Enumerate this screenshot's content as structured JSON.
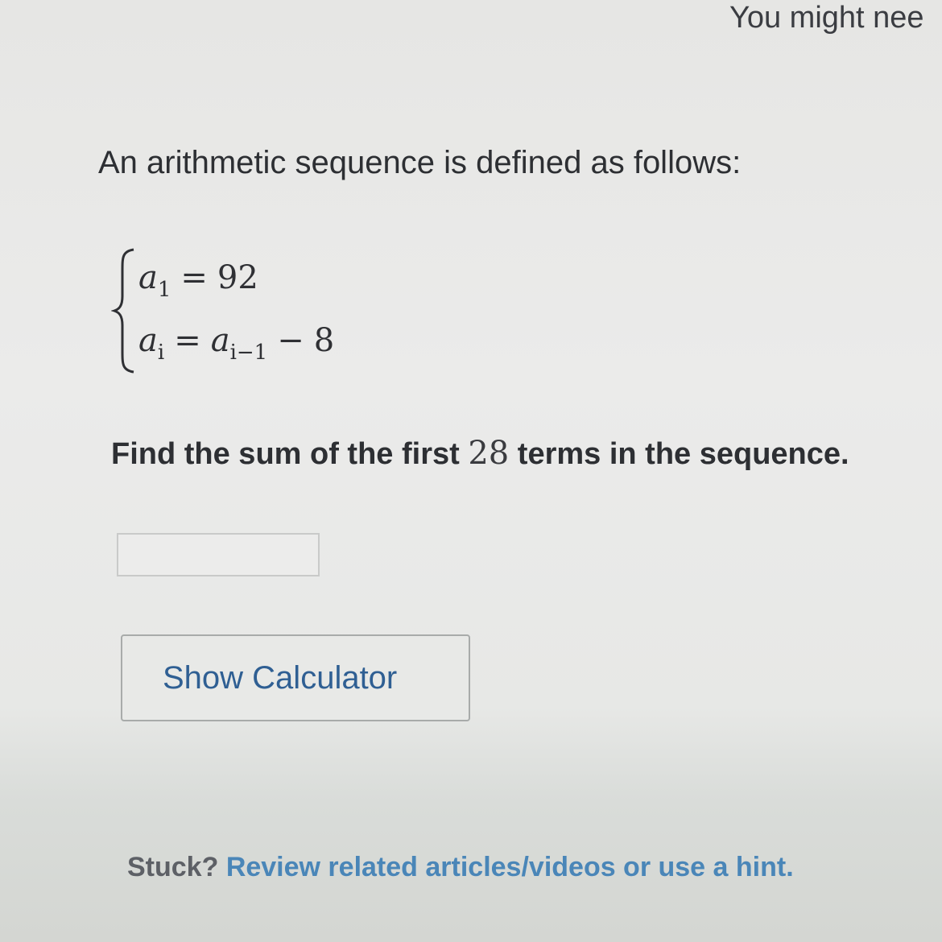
{
  "header": {
    "banner_text": "You might nee"
  },
  "problem": {
    "intro": "An arithmetic sequence is defined as follows:",
    "system": {
      "line1": {
        "var": "a",
        "sub": "1",
        "op": "=",
        "rhs": "92"
      },
      "line2": {
        "var": "a",
        "sub": "i",
        "op": "=",
        "rhs_var": "a",
        "rhs_sub": "i−1",
        "rhs_op": "−",
        "rhs_const": "8"
      }
    },
    "question_prefix": "Find the sum of the first ",
    "question_number": "28",
    "question_suffix": " terms in the sequence."
  },
  "answer": {
    "value": "",
    "placeholder": ""
  },
  "buttons": {
    "calculator_label": "Show Calculator"
  },
  "help": {
    "stuck_label": "Stuck?",
    "link_text": "Review related articles/videos or use a hint."
  },
  "colors": {
    "link": "#4a86b8",
    "button_text": "#2f5f93",
    "text": "#2d2f33"
  }
}
